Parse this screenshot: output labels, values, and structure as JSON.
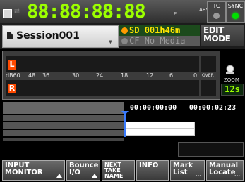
{
  "header": {
    "counter": "88:88:88:88",
    "abs_label": "ABS",
    "frame_label": "F",
    "tc_label": "TC",
    "sync_label": "SYNC",
    "loop_icon": "loop-arrow-icon",
    "stop_icon": "stop-square-icon"
  },
  "session": {
    "name": "Session001",
    "file_icon": "document-icon"
  },
  "media": {
    "sd_label": "SD",
    "sd_time": "001h46m",
    "cf_label": "CF",
    "cf_status": "No Media"
  },
  "mode": {
    "line1": "EDIT",
    "line2": "MODE"
  },
  "meter": {
    "ch_left": "L",
    "ch_right": "R",
    "scale": [
      "dB60",
      "48",
      "36",
      "30",
      "24",
      "18",
      "12",
      "6",
      "0"
    ],
    "over_label": "OVER"
  },
  "zoom": {
    "label": "ZOOM",
    "value": "12s",
    "icon": "zoom-knob-icon"
  },
  "timeline": {
    "time_start": "00:00:00:00",
    "time_end": "00:00:02:23"
  },
  "buttons": [
    {
      "line1": "INPUT",
      "line2": "MONITOR"
    },
    {
      "line1": "Bounce",
      "line2": "I/O"
    },
    {
      "line1": "NEXT",
      "line2": "TAKE",
      "line3": "NAME"
    },
    {
      "line1": "INFO"
    },
    {
      "line1": "Mark",
      "line2": "List"
    },
    {
      "line1": "Manual",
      "line2": "Locate"
    }
  ],
  "colors": {
    "counter_green": "#9cff00",
    "channel_orange": "#ff4a00",
    "sd_yellow": "#ffe600",
    "playhead_blue": "#3a7bff",
    "sync_led_green": "#00e000"
  }
}
